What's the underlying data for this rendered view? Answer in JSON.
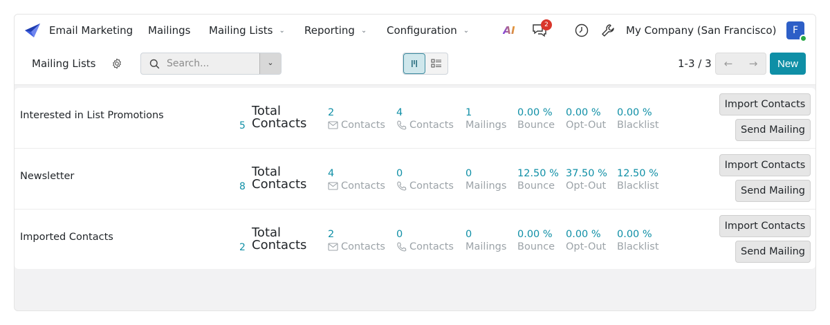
{
  "navbar": {
    "app_name": "Email Marketing",
    "menus": [
      {
        "label": "Mailings",
        "has_dropdown": false
      },
      {
        "label": "Mailing Lists",
        "has_dropdown": true
      },
      {
        "label": "Reporting",
        "has_dropdown": true
      },
      {
        "label": "Configuration",
        "has_dropdown": true
      }
    ],
    "ai_label": "AI",
    "messages_count": "2",
    "company": "My Company (San Francisco)",
    "avatar_letter": "F"
  },
  "control": {
    "title": "Mailing Lists",
    "search_placeholder": "Search...",
    "pager": "1-3 / 3",
    "new_label": "New"
  },
  "list_rows": [
    {
      "name": "Interested in List Promotions",
      "total": "5",
      "total_label_1": "Total",
      "total_label_2": "Contacts",
      "email_contacts": "2",
      "phone_contacts": "4",
      "mailings": "1",
      "bounce": "0.00 %",
      "optout": "0.00 %",
      "blacklist": "0.00 %"
    },
    {
      "name": "Newsletter",
      "total": "8",
      "total_label_1": "Total",
      "total_label_2": "Contacts",
      "email_contacts": "4",
      "phone_contacts": "0",
      "mailings": "0",
      "bounce": "12.50 %",
      "optout": "37.50 %",
      "blacklist": "12.50 %"
    },
    {
      "name": "Imported Contacts",
      "total": "2",
      "total_label_1": "Total",
      "total_label_2": "Contacts",
      "email_contacts": "2",
      "phone_contacts": "0",
      "mailings": "0",
      "bounce": "0.00 %",
      "optout": "0.00 %",
      "blacklist": "0.00 %"
    }
  ],
  "labels": {
    "contacts": "Contacts",
    "mailings": "Mailings",
    "bounce": "Bounce",
    "optout": "Opt-Out",
    "blacklist": "Blacklist",
    "import_contacts": "Import Contacts",
    "send_mailing": "Send Mailing"
  },
  "colors": {
    "accent": "#0f8fa6",
    "badge": "#d9362b",
    "avatar": "#2d5fc7",
    "online": "#28a745"
  },
  "icons": {
    "brand": "paper-plane-icon",
    "messages": "chat-bubbles-icon",
    "activity": "clock-icon",
    "debug": "wrench-icon",
    "settings": "gear-icon",
    "search": "search-icon",
    "email": "envelope-icon",
    "phone": "phone-icon"
  }
}
